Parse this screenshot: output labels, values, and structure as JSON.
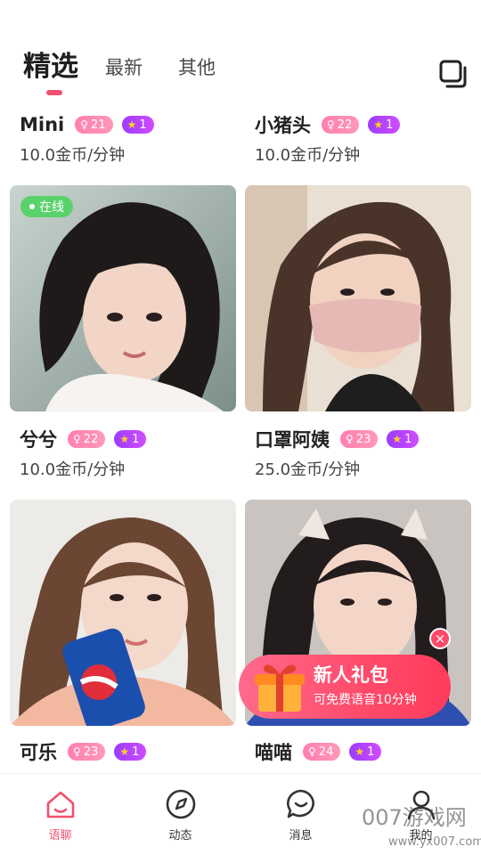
{
  "header": {
    "tabs": [
      {
        "label": "精选",
        "active": true
      },
      {
        "label": "最新",
        "active": false
      },
      {
        "label": "其他",
        "active": false
      }
    ]
  },
  "cards": [
    {
      "name": "Mini",
      "level": "21",
      "stars": "1",
      "price": "10.0金币/分钟"
    },
    {
      "name": "小猪头",
      "level": "22",
      "stars": "1",
      "price": "10.0金币/分钟"
    },
    {
      "name": "兮兮",
      "level": "22",
      "stars": "1",
      "price": "10.0金币/分钟",
      "status": "在线"
    },
    {
      "name": "口罩阿姨",
      "level": "23",
      "stars": "1",
      "price": "25.0金币/分钟"
    },
    {
      "name": "可乐",
      "level": "23",
      "stars": "1",
      "price": ""
    },
    {
      "name": "喵喵",
      "level": "24",
      "stars": "1",
      "price": ""
    }
  ],
  "promo": {
    "title": "新人礼包",
    "subtitle": "可免费语音10分钟",
    "close": "×"
  },
  "bottom_nav": [
    {
      "label": "语聊",
      "icon": "home-icon",
      "active": true
    },
    {
      "label": "动态",
      "icon": "compass-icon",
      "active": false
    },
    {
      "label": "消息",
      "icon": "message-icon",
      "active": false
    },
    {
      "label": "我的",
      "icon": "profile-icon",
      "active": false
    }
  ],
  "watermark": {
    "text": "007游戏网",
    "url": "www.yx007.com"
  },
  "colors": {
    "accent": "#f0506e",
    "online": "#5ad26b",
    "level_badge": "#ff85b2",
    "star_badge": "#b044ff"
  }
}
